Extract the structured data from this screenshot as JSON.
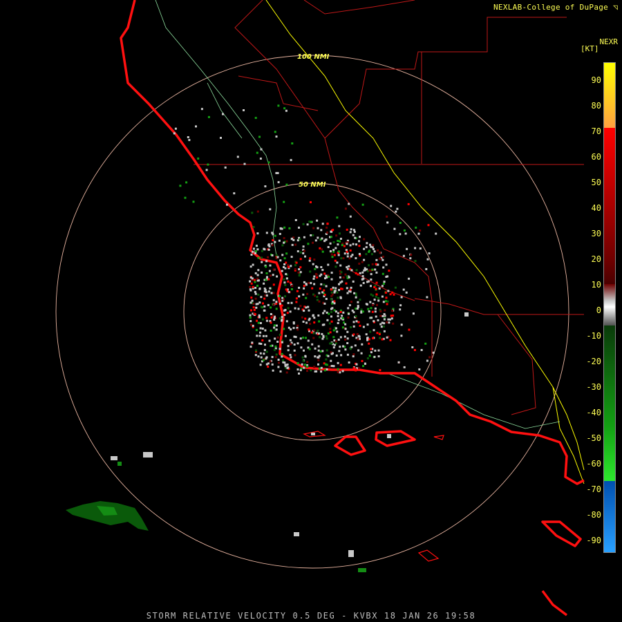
{
  "header": {
    "credit": "NEXLAB-College of DuPage",
    "credit_icon": "logo-glyph"
  },
  "legend": {
    "product": "NEXR",
    "units": "[KT]",
    "ticks": [
      "90",
      "80",
      "70",
      "60",
      "50",
      "40",
      "30",
      "20",
      "10",
      "0",
      "-10",
      "-20",
      "-30",
      "-40",
      "-50",
      "-60",
      "-70",
      "-80",
      "-90"
    ],
    "colors": {
      "gray": "#c8c8c8",
      "green_dark": "#0a5a0a",
      "green": "#13a013",
      "green_bright": "#2de82d",
      "red_dark": "#6e0000",
      "red": "#ff0000",
      "orange": "#ffa040",
      "yellow": "#ffff00",
      "blue_dark": "#0050b0",
      "blue_light": "#28a0ff"
    }
  },
  "rings": {
    "inner_label": "50 NMI",
    "outer_label": "100 NMI",
    "color": "#e8b4a0"
  },
  "map_colors": {
    "coast": "#ff1010",
    "county": "#c01818",
    "road": "#8fe0a0",
    "yellow_line": "#ffff00"
  },
  "footer": {
    "caption": "STORM RELATIVE VELOCITY 0.5 DEG - KVBX 18 JAN 26 19:58"
  }
}
